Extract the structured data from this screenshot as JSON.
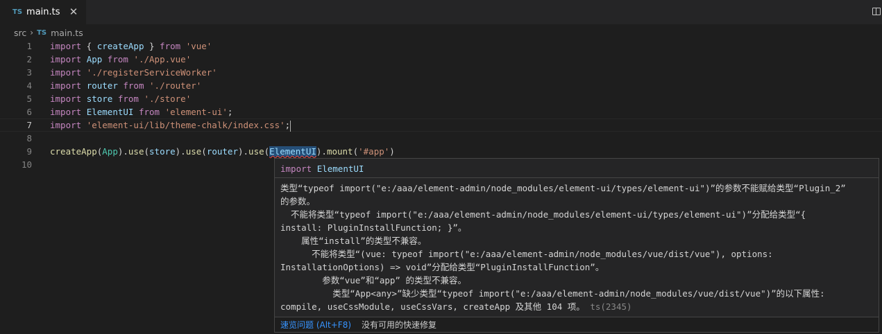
{
  "tab": {
    "icon_text": "TS",
    "file_name": "main.ts",
    "close_glyph": "✕"
  },
  "breadcrumb": {
    "folder": "src",
    "separator": "›",
    "icon_text": "TS",
    "file": "main.ts"
  },
  "editor": {
    "line_numbers": [
      "1",
      "2",
      "3",
      "4",
      "5",
      "6",
      "7",
      "8",
      "9",
      "10"
    ],
    "lines": [
      [
        {
          "t": "import",
          "c": "kw"
        },
        {
          "t": " { ",
          "c": "pl"
        },
        {
          "t": "createApp",
          "c": "var"
        },
        {
          "t": " } ",
          "c": "pl"
        },
        {
          "t": "from",
          "c": "kw"
        },
        {
          "t": " ",
          "c": "pl"
        },
        {
          "t": "'vue'",
          "c": "str"
        }
      ],
      [
        {
          "t": "import",
          "c": "kw"
        },
        {
          "t": " ",
          "c": "pl"
        },
        {
          "t": "App",
          "c": "var"
        },
        {
          "t": " ",
          "c": "pl"
        },
        {
          "t": "from",
          "c": "kw"
        },
        {
          "t": " ",
          "c": "pl"
        },
        {
          "t": "'./App.vue'",
          "c": "str"
        }
      ],
      [
        {
          "t": "import",
          "c": "kw"
        },
        {
          "t": " ",
          "c": "pl"
        },
        {
          "t": "'./registerServiceWorker'",
          "c": "str"
        }
      ],
      [
        {
          "t": "import",
          "c": "kw"
        },
        {
          "t": " ",
          "c": "pl"
        },
        {
          "t": "router",
          "c": "var"
        },
        {
          "t": " ",
          "c": "pl"
        },
        {
          "t": "from",
          "c": "kw"
        },
        {
          "t": " ",
          "c": "pl"
        },
        {
          "t": "'./router'",
          "c": "str"
        }
      ],
      [
        {
          "t": "import",
          "c": "kw"
        },
        {
          "t": " ",
          "c": "pl"
        },
        {
          "t": "store",
          "c": "var"
        },
        {
          "t": " ",
          "c": "pl"
        },
        {
          "t": "from",
          "c": "kw"
        },
        {
          "t": " ",
          "c": "pl"
        },
        {
          "t": "'./store'",
          "c": "str"
        }
      ],
      [
        {
          "t": "import",
          "c": "kw"
        },
        {
          "t": " ",
          "c": "pl"
        },
        {
          "t": "ElementUI",
          "c": "var"
        },
        {
          "t": " ",
          "c": "pl"
        },
        {
          "t": "from",
          "c": "kw"
        },
        {
          "t": " ",
          "c": "pl"
        },
        {
          "t": "'element-ui'",
          "c": "str"
        },
        {
          "t": ";",
          "c": "pl"
        }
      ],
      [
        {
          "t": "import",
          "c": "kw"
        },
        {
          "t": " ",
          "c": "pl"
        },
        {
          "t": "'element-ui/lib/theme-chalk/index.css'",
          "c": "str"
        },
        {
          "t": ";",
          "c": "pl"
        }
      ],
      [],
      [
        {
          "t": "createApp",
          "c": "fn"
        },
        {
          "t": "(",
          "c": "pl"
        },
        {
          "t": "App",
          "c": "cls"
        },
        {
          "t": ").",
          "c": "pl"
        },
        {
          "t": "use",
          "c": "fn"
        },
        {
          "t": "(",
          "c": "pl"
        },
        {
          "t": "store",
          "c": "var"
        },
        {
          "t": ").",
          "c": "pl"
        },
        {
          "t": "use",
          "c": "fn"
        },
        {
          "t": "(",
          "c": "pl"
        },
        {
          "t": "router",
          "c": "var"
        },
        {
          "t": ").",
          "c": "pl"
        },
        {
          "t": "use",
          "c": "fn"
        },
        {
          "t": "(",
          "c": "pl"
        },
        {
          "t": "ElementUI",
          "c": "var hl squiggle"
        },
        {
          "t": ").",
          "c": "pl"
        },
        {
          "t": "mount",
          "c": "fn"
        },
        {
          "t": "(",
          "c": "pl"
        },
        {
          "t": "'#app'",
          "c": "str"
        },
        {
          "t": ")",
          "c": "pl"
        }
      ],
      []
    ]
  },
  "hover": {
    "signature_keyword": "import",
    "signature_name": "ElementUI",
    "message_lines": [
      "类型“typeof import(\"e:/aaa/element-admin/node_modules/element-ui/types/element-ui\")”的参数不能赋给类型“Plugin_2”",
      "的参数。",
      "  不能将类型“typeof import(\"e:/aaa/element-admin/node_modules/element-ui/types/element-ui\")”分配给类型“{",
      "install: PluginInstallFunction; }”。",
      "    属性“install”的类型不兼容。",
      "      不能将类型“(vue: typeof import(\"e:/aaa/element-admin/node_modules/vue/dist/vue\"), options:",
      "InstallationOptions) => void”分配给类型“PluginInstallFunction”。",
      "        参数“vue”和“app” 的类型不兼容。",
      "          类型“App<any>”缺少类型“typeof import(\"e:/aaa/element-admin/node_modules/vue/dist/vue\")”的以下属性:",
      "compile, useCssModule, useCssVars, createApp 及其他 104 项。"
    ],
    "error_code": "ts(2345)",
    "peek_problem": "速览问题 (Alt+F8)",
    "no_quick_fix": "没有可用的快速修复"
  }
}
